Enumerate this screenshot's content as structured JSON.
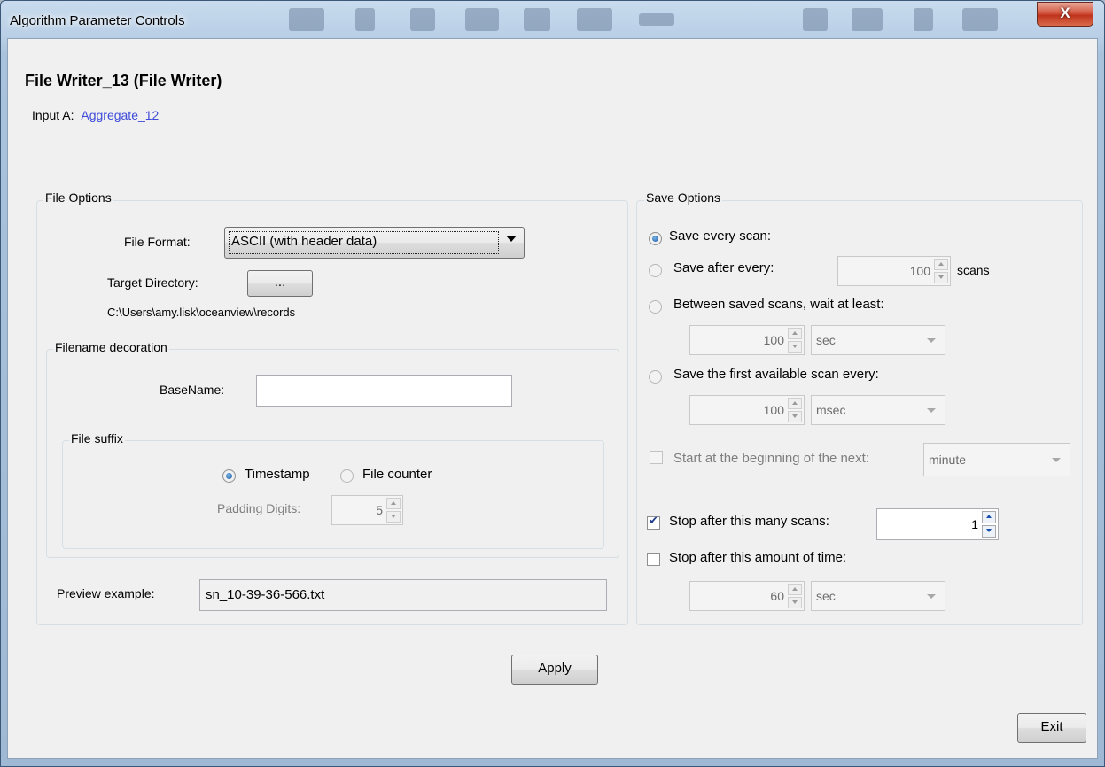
{
  "window": {
    "title": "Algorithm Parameter Controls",
    "close_label": "X"
  },
  "header": {
    "title": "File Writer_13 (File Writer)",
    "input_label": "Input A:",
    "input_link": "Aggregate_12"
  },
  "file_options": {
    "legend": "File Options",
    "file_format_label": "File Format:",
    "file_format_value": "ASCII (with header data)",
    "target_dir_label": "Target Directory:",
    "browse_label": "...",
    "target_dir_path": "C:\\Users\\amy.lisk\\oceanview\\records",
    "decoration": {
      "legend": "Filename decoration",
      "basename_label": "BaseName:",
      "basename_value": "",
      "suffix": {
        "legend": "File suffix",
        "timestamp_label": "Timestamp",
        "timestamp_selected": true,
        "counter_label": "File counter",
        "padding_label": "Padding Digits:",
        "padding_value": "5"
      }
    },
    "preview_label": "Preview example:",
    "preview_value": "sn_10-39-36-566.txt"
  },
  "save_options": {
    "legend": "Save Options",
    "every_scan_label": "Save every scan:",
    "after_every_label": "Save after every:",
    "after_every_value": "100",
    "scans_unit": "scans",
    "between_label": "Between saved scans, wait at least:",
    "between_value": "100",
    "between_unit": "sec",
    "first_available_label": "Save the first available scan every:",
    "first_available_value": "100",
    "first_available_unit": "msec",
    "start_next_label": "Start at the beginning of the next:",
    "start_next_unit": "minute",
    "stop_scans_label": "Stop after this many scans:",
    "stop_scans_checked": true,
    "stop_scans_value": "1",
    "stop_time_label": "Stop after this amount of time:",
    "stop_time_value": "60",
    "stop_time_unit": "sec"
  },
  "buttons": {
    "apply": "Apply",
    "exit": "Exit"
  }
}
